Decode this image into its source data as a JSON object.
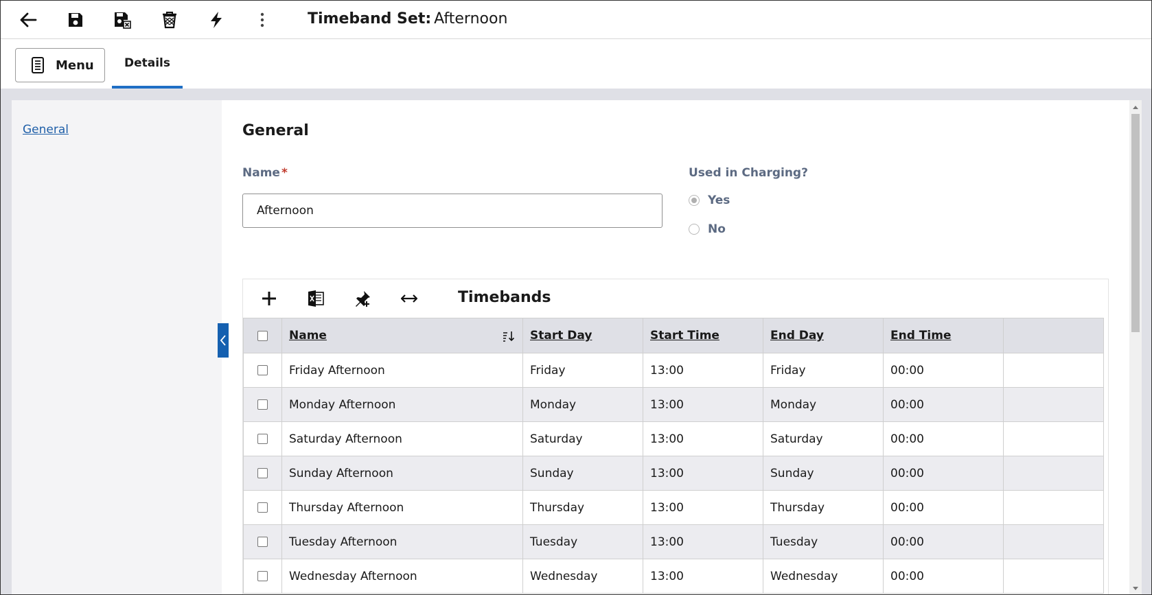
{
  "toolbar": {
    "icons": [
      "back-arrow-icon",
      "save-icon",
      "save-close-icon",
      "delete-icon",
      "actions-bolt-icon",
      "more-vertical-icon"
    ]
  },
  "header": {
    "title_label": "Timeband Set:",
    "title_value": "Afternoon"
  },
  "tabs": {
    "menu_label": "Menu",
    "details_label": "Details"
  },
  "leftnav": {
    "items": [
      {
        "label": "General"
      }
    ]
  },
  "general": {
    "section_title": "General",
    "name_label": "Name",
    "name_required": "*",
    "name_value": "Afternoon",
    "charging_label": "Used in Charging?",
    "charging_options": [
      {
        "label": "Yes",
        "selected": true
      },
      {
        "label": "No",
        "selected": false
      }
    ]
  },
  "timebands": {
    "title": "Timebands",
    "toolbar_icons": [
      "add-icon",
      "excel-export-icon",
      "pin-icon",
      "resize-columns-icon"
    ],
    "columns": [
      "Name",
      "Start Day",
      "Start Time",
      "End Day",
      "End Time"
    ],
    "rows": [
      [
        "Friday Afternoon",
        "Friday",
        "13:00",
        "Friday",
        "00:00"
      ],
      [
        "Monday Afternoon",
        "Monday",
        "13:00",
        "Monday",
        "00:00"
      ],
      [
        "Saturday Afternoon",
        "Saturday",
        "13:00",
        "Saturday",
        "00:00"
      ],
      [
        "Sunday Afternoon",
        "Sunday",
        "13:00",
        "Sunday",
        "00:00"
      ],
      [
        "Thursday Afternoon",
        "Thursday",
        "13:00",
        "Thursday",
        "00:00"
      ],
      [
        "Tuesday Afternoon",
        "Tuesday",
        "13:00",
        "Tuesday",
        "00:00"
      ],
      [
        "Wednesday Afternoon",
        "Wednesday",
        "13:00",
        "Wednesday",
        "00:00"
      ]
    ]
  },
  "colors": {
    "accent": "#1f6fc5",
    "link": "#1f5fa8",
    "header_bg": "#dfe0e6",
    "row_alt": "#ececf0",
    "required": "#c0392b"
  }
}
